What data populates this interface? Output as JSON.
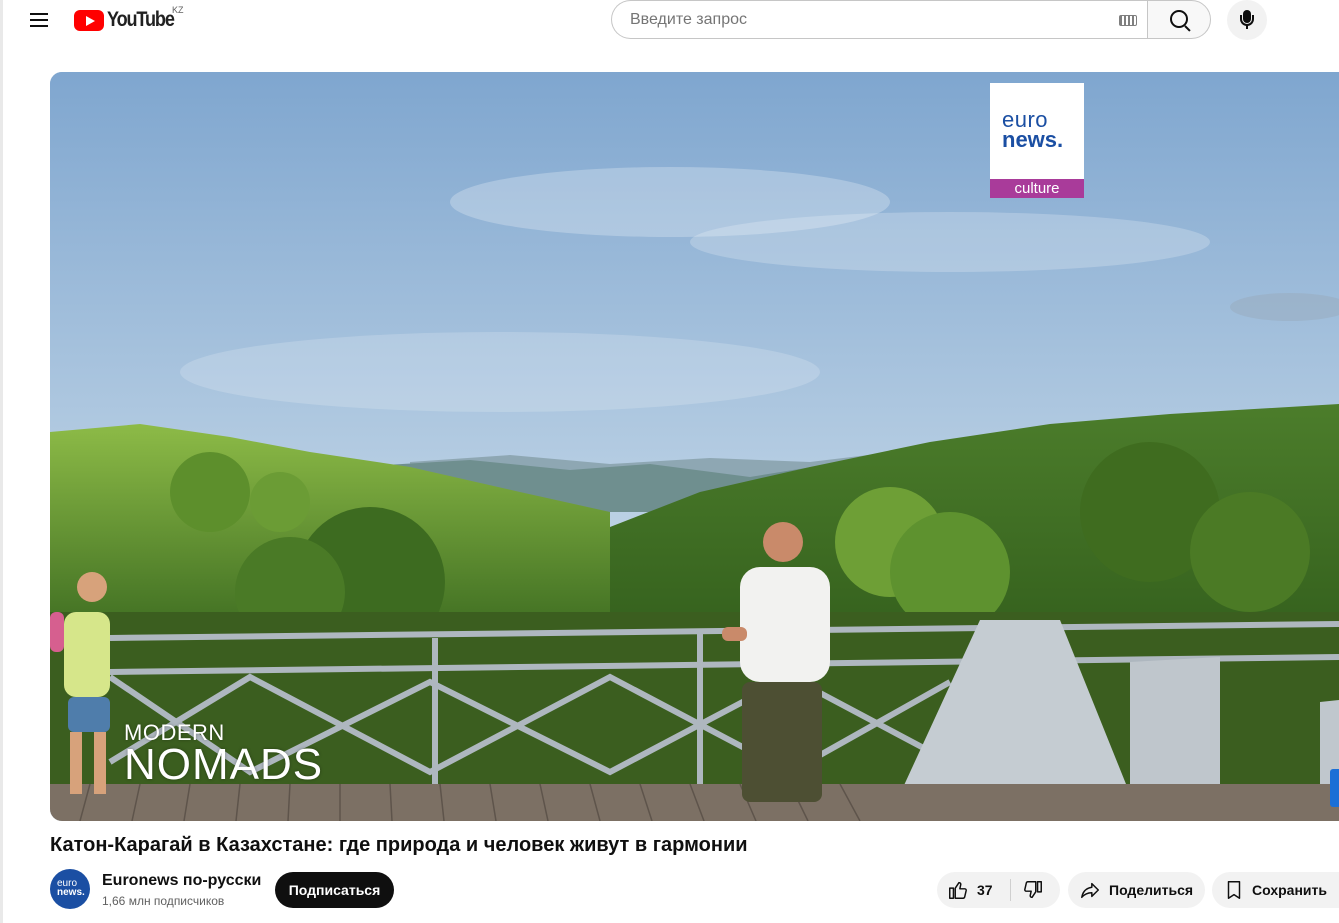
{
  "masthead": {
    "menu_icon": "hamburger-menu-icon",
    "logo_text": "YouTube",
    "region_code": "KZ",
    "search_placeholder": "Введите запрос",
    "search_value": "",
    "keyboard_icon": "keyboard-icon",
    "search_icon": "search-icon",
    "mic_icon": "microphone-icon"
  },
  "player": {
    "channel_badge": {
      "line1": "euro",
      "line2": "news.",
      "line3": "culture"
    },
    "program_title": {
      "line1": "MODERN",
      "line2": "NOMADS"
    }
  },
  "video": {
    "title": "Катон-Карагай в Казахстане: где природа и человек живут в гармонии"
  },
  "channel": {
    "avatar": {
      "line1": "euro",
      "line2": "news."
    },
    "name": "Euronews по-русски",
    "subscribers": "1,66 млн подписчиков",
    "subscribe_label": "Подписаться"
  },
  "actions": {
    "like_icon": "thumbs-up-icon",
    "like_count": "37",
    "dislike_icon": "thumbs-down-icon",
    "share_icon": "share-icon",
    "share_label": "Поделиться",
    "save_icon": "save-icon",
    "save_label": "Сохранить"
  },
  "colors": {
    "brand_red": "#ff0000",
    "euronews_blue": "#1b4fa3",
    "culture_purple": "#a93b9a",
    "subscribe_bg": "#0f0f0f"
  }
}
